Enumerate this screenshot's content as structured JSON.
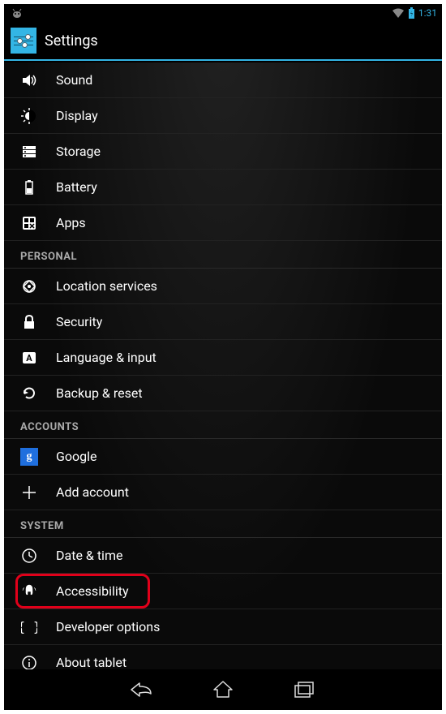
{
  "statusbar": {
    "time": "1:31"
  },
  "appbar": {
    "title": "Settings"
  },
  "sections": [
    {
      "header": null,
      "items": [
        {
          "id": "sound",
          "label": "Sound"
        },
        {
          "id": "display",
          "label": "Display"
        },
        {
          "id": "storage",
          "label": "Storage"
        },
        {
          "id": "battery",
          "label": "Battery"
        },
        {
          "id": "apps",
          "label": "Apps"
        }
      ]
    },
    {
      "header": "PERSONAL",
      "items": [
        {
          "id": "location",
          "label": "Location services"
        },
        {
          "id": "security",
          "label": "Security"
        },
        {
          "id": "language",
          "label": "Language & input"
        },
        {
          "id": "backup",
          "label": "Backup & reset"
        }
      ]
    },
    {
      "header": "ACCOUNTS",
      "items": [
        {
          "id": "google",
          "label": "Google"
        },
        {
          "id": "addaccount",
          "label": "Add account"
        }
      ]
    },
    {
      "header": "SYSTEM",
      "items": [
        {
          "id": "datetime",
          "label": "Date & time"
        },
        {
          "id": "accessibility",
          "label": "Accessibility",
          "highlighted": true
        },
        {
          "id": "developer",
          "label": "Developer options"
        },
        {
          "id": "about",
          "label": "About tablet"
        }
      ]
    }
  ]
}
